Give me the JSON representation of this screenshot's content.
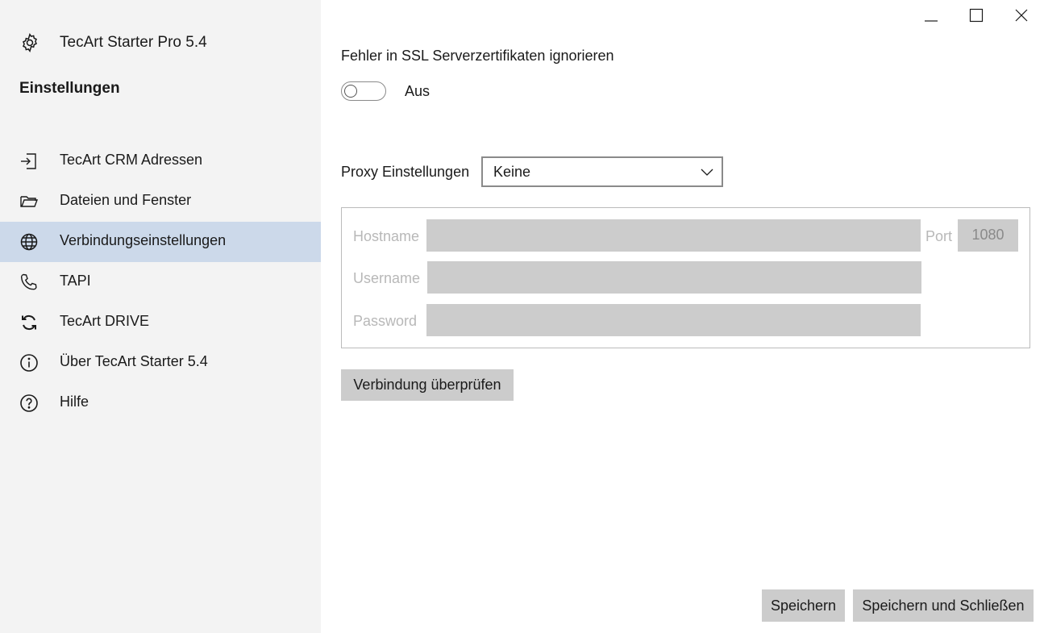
{
  "app": {
    "title": "TecArt Starter Pro 5.4"
  },
  "sidebar": {
    "section_title": "Einstellungen",
    "items": [
      {
        "label": "TecArt CRM Adressen",
        "icon": "sign-in-icon",
        "active": false
      },
      {
        "label": "Dateien und Fenster",
        "icon": "folder-icon",
        "active": false
      },
      {
        "label": "Verbindungseinstellungen",
        "icon": "globe-icon",
        "active": true
      },
      {
        "label": "TAPI",
        "icon": "phone-icon",
        "active": false
      },
      {
        "label": "TecArt DRIVE",
        "icon": "sync-icon",
        "active": false
      },
      {
        "label": "Über TecArt Starter 5.4",
        "icon": "info-icon",
        "active": false
      },
      {
        "label": "Hilfe",
        "icon": "help-icon",
        "active": false
      }
    ]
  },
  "ssl": {
    "label": "Fehler in SSL Serverzertifikaten ignorieren",
    "toggle_state": "Aus",
    "enabled": false
  },
  "proxy": {
    "label": "Proxy Einstellungen",
    "selected": "Keine",
    "hostname_label": "Hostname",
    "hostname_value": "",
    "port_label": "Port",
    "port_value": "1080",
    "username_label": "Username",
    "username_value": "",
    "password_label": "Password",
    "password_value": ""
  },
  "buttons": {
    "check": "Verbindung überprüfen",
    "save": "Speichern",
    "save_close": "Speichern und Schließen"
  },
  "colors": {
    "sidebar_bg": "#f3f3f3",
    "active_item_bg": "#ccd9ea",
    "button_bg": "#cccccc",
    "disabled_input_bg": "#cccccc"
  }
}
